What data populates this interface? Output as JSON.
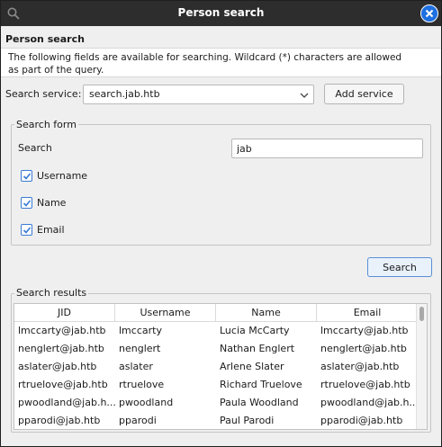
{
  "window": {
    "title": "Person search"
  },
  "icons": {
    "title_search": "search-icon",
    "close": "close-icon",
    "dropdown": "chevron-down-icon",
    "checkmark": "checkmark-icon"
  },
  "colors": {
    "titlebar": "#2d2d2d",
    "accent": "#1e6fe0",
    "background": "#efefef"
  },
  "header": {
    "heading": "Person search",
    "description": "The following fields are available for searching. Wildcard (*) characters are allowed as part of the query."
  },
  "service": {
    "label": "Search service:",
    "selected": "search.jab.htb",
    "add_button": "Add service"
  },
  "form": {
    "title": "Search form",
    "search_label": "Search",
    "search_value": "jab",
    "checkboxes": [
      {
        "label": "Username",
        "checked": true
      },
      {
        "label": "Name",
        "checked": true
      },
      {
        "label": "Email",
        "checked": true
      }
    ],
    "search_button": "Search"
  },
  "results": {
    "title": "Search results",
    "columns": [
      "JID",
      "Username",
      "Name",
      "Email"
    ],
    "rows": [
      [
        "lmccarty@jab.htb",
        "lmccarty",
        "Lucia McCarty",
        "lmccarty@jab.htb"
      ],
      [
        "nenglert@jab.htb",
        "nenglert",
        "Nathan Englert",
        "nenglert@jab.htb"
      ],
      [
        "aslater@jab.htb",
        "aslater",
        "Arlene Slater",
        "aslater@jab.htb"
      ],
      [
        "rtruelove@jab.htb",
        "rtruelove",
        "Richard Truelove",
        "rtruelove@jab.htb"
      ],
      [
        "pwoodland@jab.h...",
        "pwoodland",
        "Paula Woodland",
        "pwoodland@jab.h..."
      ],
      [
        "pparodi@jab.htb",
        "pparodi",
        "Paul Parodi",
        "pparodi@jab.htb"
      ]
    ]
  }
}
